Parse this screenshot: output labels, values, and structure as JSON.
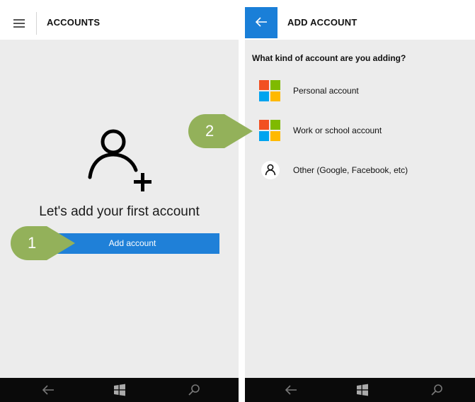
{
  "left_screen": {
    "title": "ACCOUNTS",
    "empty_state_text": "Let's add your first account",
    "add_account_button": "Add account"
  },
  "right_screen": {
    "title": "ADD ACCOUNT",
    "question": "What kind of account are you adding?",
    "account_types": [
      {
        "label": "Personal account",
        "icon": "microsoft-logo-icon"
      },
      {
        "label": "Work or school account",
        "icon": "microsoft-logo-icon"
      },
      {
        "label": "Other (Google, Facebook, etc)",
        "icon": "person-icon"
      }
    ]
  },
  "callouts": [
    "1",
    "2"
  ],
  "colors": {
    "accent": "#1f80d8",
    "callout_green": "#93b15a",
    "ms_red": "#f25022",
    "ms_green": "#7fba00",
    "ms_blue": "#00a4ef",
    "ms_yellow": "#ffb900"
  }
}
